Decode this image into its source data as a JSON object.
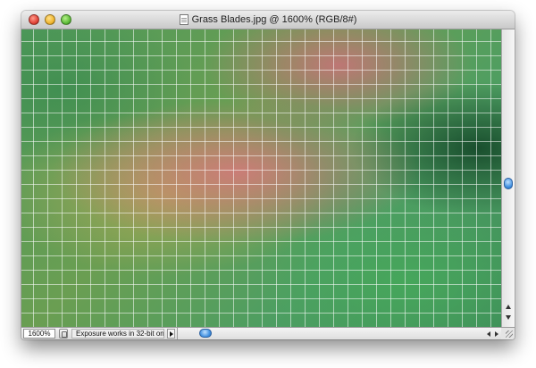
{
  "window": {
    "title": "Grass Blades.jpg @ 1600% (RGB/8#)"
  },
  "status": {
    "zoom_value": "1600%",
    "info_text": "Exposure works in 32-bit only"
  },
  "icons": {
    "close": "close-button",
    "minimize": "minimize-button",
    "zoom": "zoom-button",
    "document": "document-icon",
    "status": "status-icon",
    "menu": "status-menu-arrow-icon"
  },
  "scroll": {
    "vertical_position": 0.5,
    "horizontal_position": 0.07
  },
  "colors": {
    "pixel_grid": "#ffffff",
    "scroll_thumb": "#3f8fe0"
  }
}
